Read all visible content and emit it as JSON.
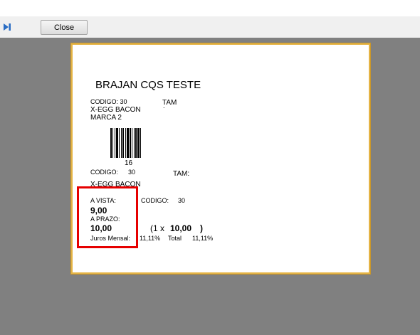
{
  "toolbar": {
    "close_label": "Close",
    "nav_icon": "last-page-icon"
  },
  "label": {
    "store_name": "BRAJAN CQS TESTE",
    "codigo_1": "CODIGO:  30",
    "tam_1": "TAM",
    "tam_1_value": ".",
    "product_1": "X-EGG BACON",
    "brand": "MARCA 2",
    "barcode_number": "16",
    "codigo_2_label": "CODIGO:",
    "codigo_2_value": "30",
    "tam_2": "TAM:",
    "product_2": "X-EGG BACON",
    "a_vista_label": "A VISTA:",
    "a_vista_value": "9,00",
    "codigo_3_label": "CODIGO:",
    "codigo_3_value": "30",
    "a_prazo_label": "A PRAZO:",
    "a_prazo_value": "10,00",
    "installments_open": "(1 x",
    "installment_value": "10,00",
    "installments_close": ")",
    "juros_label": "Juros Mensal:",
    "juros_value": "11,11%",
    "total_label": "Total",
    "total_value": "11,11%"
  },
  "colors": {
    "viewport_bg": "#808080",
    "page_border": "#e5b445",
    "highlight_border": "#e60000"
  }
}
